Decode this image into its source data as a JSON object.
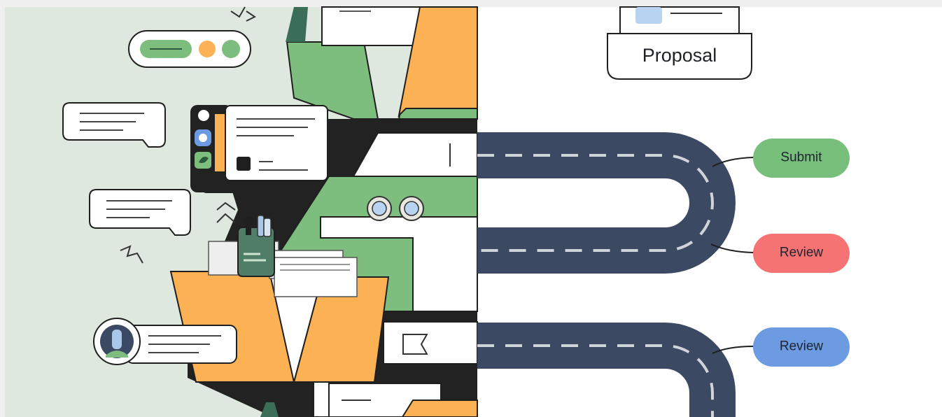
{
  "proposal": {
    "label": "Proposal"
  },
  "pills": [
    {
      "label": "Submit",
      "color": "#79bf7c"
    },
    {
      "label": "Review",
      "color": "#f57373"
    },
    {
      "label": "Review",
      "color": "#6c9be2"
    }
  ],
  "palette": {
    "road": "#3b4a62",
    "mint_bg": "#dfe8df",
    "green": "#7dbd7e",
    "orange": "#fbb154",
    "ink": "#1f1f1f",
    "white": "#ffffff",
    "light_blue": "#b8d4f0"
  }
}
